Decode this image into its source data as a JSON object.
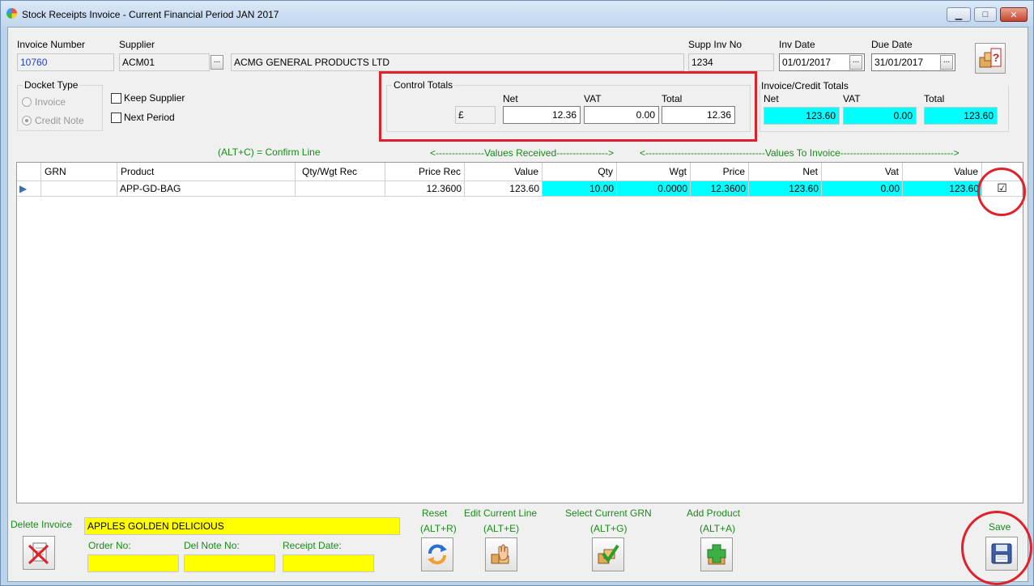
{
  "window": {
    "title": "Stock Receipts Invoice - Current Financial Period JAN 2017",
    "min": "▁",
    "max": "□",
    "close": "✕"
  },
  "header": {
    "invoice_number_label": "Invoice Number",
    "invoice_number": "10760",
    "supplier_label": "Supplier",
    "supplier_code": "ACM01",
    "supplier_name": "ACMG GENERAL PRODUCTS LTD",
    "supp_inv_no_label": "Supp Inv No",
    "supp_inv_no": "1234",
    "inv_date_label": "Inv Date",
    "inv_date": "01/01/2017",
    "due_date_label": "Due Date",
    "due_date": "31/01/2017",
    "lookup": "..."
  },
  "docket": {
    "title": "Docket Type",
    "invoice": "Invoice",
    "credit_note": "Credit Note",
    "selected": "Credit Note"
  },
  "options": {
    "keep_supplier": "Keep Supplier",
    "next_period": "Next Period"
  },
  "control_totals": {
    "title": "Control Totals",
    "currency": "£",
    "net_label": "Net",
    "vat_label": "VAT",
    "total_label": "Total",
    "net": "12.36",
    "vat": "0.00",
    "total": "12.36"
  },
  "invoice_totals": {
    "title": "Invoice/Credit Totals",
    "net_label": "Net",
    "vat_label": "VAT",
    "total_label": "Total",
    "net": "123.60",
    "vat": "0.00",
    "total": "123.60"
  },
  "grid_captions": {
    "confirm_line": "(ALT+C) = Confirm Line",
    "values_received": "<---------------Values Received---------------->",
    "values_to_invoice": "<-------------------------------------Values To Invoice----------------------------------->"
  },
  "grid": {
    "columns": [
      "GRN",
      "Product",
      "Qty/Wgt Rec",
      "Price Rec",
      "Value",
      "Qty",
      "Wgt",
      "Price",
      "Net",
      "Vat",
      "Value"
    ],
    "rows": [
      {
        "grn": "",
        "product": "APP-GD-BAG",
        "qty_wgt_rec": "",
        "price_rec": "12.3600",
        "value_rec": "123.60",
        "qty": "10.00",
        "wgt": "0.0000",
        "price": "12.3600",
        "net": "123.60",
        "vat": "0.00",
        "value": "123.60",
        "confirmed": "☑"
      }
    ]
  },
  "footer": {
    "delete_invoice": "Delete Invoice",
    "product_description": "APPLES GOLDEN DELICIOUS",
    "order_no_label": "Order No:",
    "del_note_label": "Del Note No:",
    "receipt_date_label": "Receipt Date:",
    "reset_label": "Reset",
    "reset_key": "(ALT+R)",
    "edit_label": "Edit Current Line",
    "edit_key": "(ALT+E)",
    "select_grn_label": "Select Current GRN",
    "select_grn_key": "(ALT+G)",
    "add_product_label": "Add Product",
    "add_product_key": "(ALT+A)",
    "save_label": "Save"
  },
  "colors": {
    "accent_cyan": "#00ffff",
    "highlight_yellow": "#ffff00",
    "annotation_red": "#e0202a",
    "shortcut_green": "#1a8a1a"
  }
}
